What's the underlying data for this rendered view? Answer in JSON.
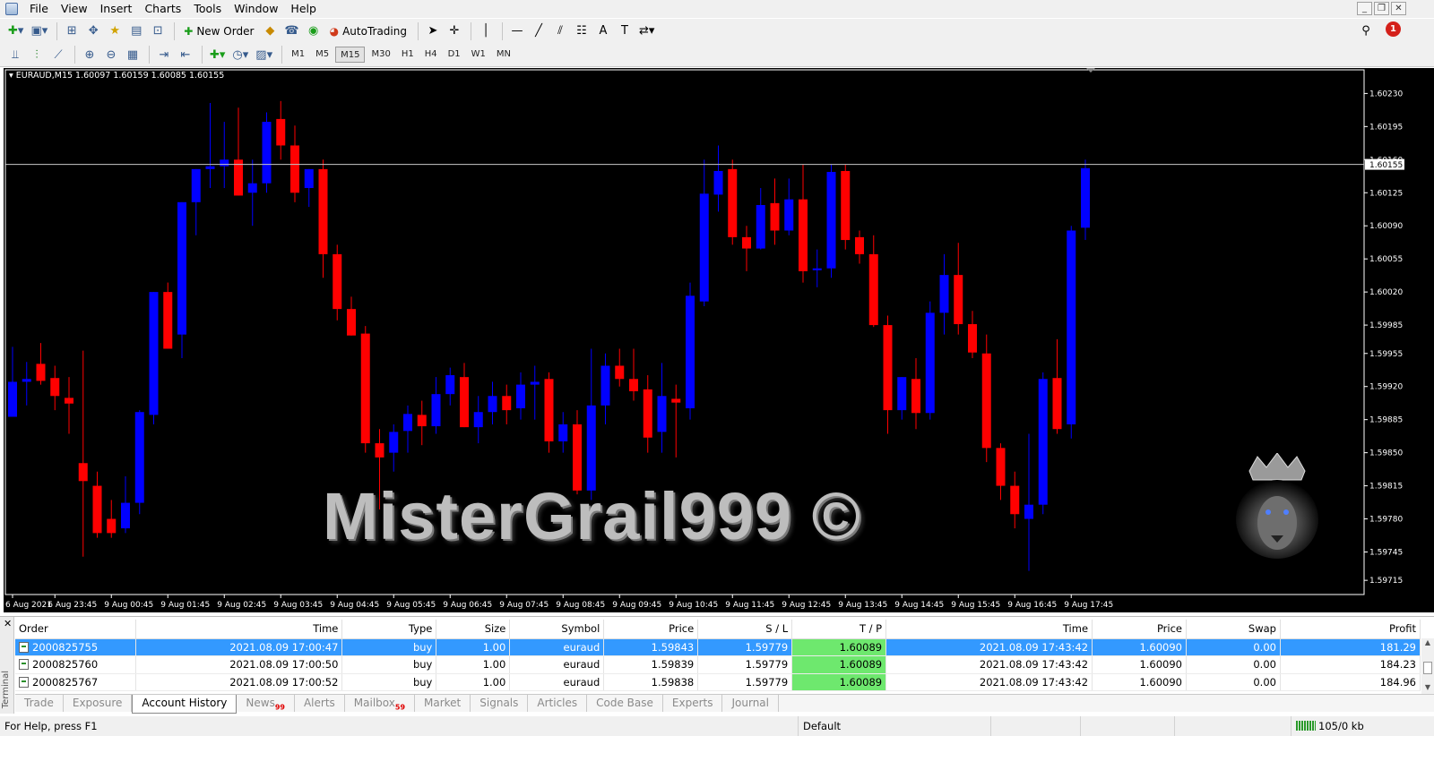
{
  "menu": [
    "File",
    "View",
    "Insert",
    "Charts",
    "Tools",
    "Window",
    "Help"
  ],
  "toolbar": {
    "new_order": "New Order",
    "autotrading": "AutoTrading",
    "alert_count": "1"
  },
  "timeframes": [
    "M1",
    "M5",
    "M15",
    "M30",
    "H1",
    "H4",
    "D1",
    "W1",
    "MN"
  ],
  "active_timeframe": "M15",
  "chart": {
    "header": "EURAUD,M15  1.60097 1.60159 1.60085 1.60155",
    "current_price": "1.60155",
    "price_labels": [
      "1.60230",
      "1.60195",
      "1.60160",
      "1.60125",
      "1.60090",
      "1.60055",
      "1.60020",
      "1.59985",
      "1.59955",
      "1.59920",
      "1.59885",
      "1.59850",
      "1.59815",
      "1.59780",
      "1.59745",
      "1.59715"
    ],
    "time_labels": [
      "6 Aug 2021",
      "6 Aug 23:45",
      "9 Aug 00:45",
      "9 Aug 01:45",
      "9 Aug 02:45",
      "9 Aug 03:45",
      "9 Aug 04:45",
      "9 Aug 05:45",
      "9 Aug 06:45",
      "9 Aug 07:45",
      "9 Aug 08:45",
      "9 Aug 09:45",
      "9 Aug 10:45",
      "9 Aug 11:45",
      "9 Aug 12:45",
      "9 Aug 13:45",
      "9 Aug 14:45",
      "9 Aug 15:45",
      "9 Aug 16:45",
      "9 Aug 17:45"
    ],
    "watermark": "MisterGrail999 ©",
    "bull_color": "#0000ff",
    "bear_color": "#ff0000"
  },
  "chart_data": {
    "type": "candlestick",
    "symbol": "EURAUD",
    "timeframe": "M15",
    "ylim": [
      1.597,
      1.60255
    ],
    "candles": [
      {
        "o": 1.59888,
        "h": 1.59962,
        "l": 1.59888,
        "c": 1.59925
      },
      {
        "o": 1.59925,
        "h": 1.59946,
        "l": 1.599,
        "c": 1.59928
      },
      {
        "o": 1.59944,
        "h": 1.59966,
        "l": 1.59922,
        "c": 1.59926
      },
      {
        "o": 1.59929,
        "h": 1.59942,
        "l": 1.59895,
        "c": 1.5991
      },
      {
        "o": 1.59908,
        "h": 1.5993,
        "l": 1.5987,
        "c": 1.59902
      },
      {
        "o": 1.59839,
        "h": 1.59958,
        "l": 1.5974,
        "c": 1.5982
      },
      {
        "o": 1.59815,
        "h": 1.5983,
        "l": 1.5976,
        "c": 1.59765
      },
      {
        "o": 1.5978,
        "h": 1.598,
        "l": 1.5976,
        "c": 1.59765
      },
      {
        "o": 1.5977,
        "h": 1.59825,
        "l": 1.59765,
        "c": 1.59797
      },
      {
        "o": 1.59797,
        "h": 1.59895,
        "l": 1.59785,
        "c": 1.59893
      },
      {
        "o": 1.5989,
        "h": 1.59985,
        "l": 1.5988,
        "c": 1.6002
      },
      {
        "o": 1.6002,
        "h": 1.6003,
        "l": 1.5996,
        "c": 1.5996
      },
      {
        "o": 1.59975,
        "h": 1.601,
        "l": 1.5995,
        "c": 1.60115
      },
      {
        "o": 1.60115,
        "h": 1.6014,
        "l": 1.6008,
        "c": 1.6015
      },
      {
        "o": 1.6015,
        "h": 1.6022,
        "l": 1.6013,
        "c": 1.60153
      },
      {
        "o": 1.60153,
        "h": 1.602,
        "l": 1.6013,
        "c": 1.6016
      },
      {
        "o": 1.6016,
        "h": 1.60215,
        "l": 1.60135,
        "c": 1.60122
      },
      {
        "o": 1.60125,
        "h": 1.6016,
        "l": 1.6009,
        "c": 1.60135
      },
      {
        "o": 1.60135,
        "h": 1.6021,
        "l": 1.60125,
        "c": 1.602
      },
      {
        "o": 1.60203,
        "h": 1.60222,
        "l": 1.6016,
        "c": 1.60175
      },
      {
        "o": 1.60175,
        "h": 1.60196,
        "l": 1.60115,
        "c": 1.60125
      },
      {
        "o": 1.6013,
        "h": 1.6015,
        "l": 1.6011,
        "c": 1.6015
      },
      {
        "o": 1.6015,
        "h": 1.6016,
        "l": 1.60035,
        "c": 1.6006
      },
      {
        "o": 1.6006,
        "h": 1.6007,
        "l": 1.5999,
        "c": 1.60002
      },
      {
        "o": 1.60002,
        "h": 1.60015,
        "l": 1.5998,
        "c": 1.59974
      },
      {
        "o": 1.59976,
        "h": 1.59984,
        "l": 1.5985,
        "c": 1.5986
      },
      {
        "o": 1.5986,
        "h": 1.59875,
        "l": 1.5979,
        "c": 1.59845
      },
      {
        "o": 1.5985,
        "h": 1.5988,
        "l": 1.5983,
        "c": 1.59872
      },
      {
        "o": 1.59873,
        "h": 1.599,
        "l": 1.5985,
        "c": 1.59891
      },
      {
        "o": 1.5989,
        "h": 1.59905,
        "l": 1.59858,
        "c": 1.59878
      },
      {
        "o": 1.59878,
        "h": 1.5993,
        "l": 1.5987,
        "c": 1.59912
      },
      {
        "o": 1.59912,
        "h": 1.5994,
        "l": 1.599,
        "c": 1.59932
      },
      {
        "o": 1.5993,
        "h": 1.59945,
        "l": 1.5988,
        "c": 1.59877
      },
      {
        "o": 1.59877,
        "h": 1.5991,
        "l": 1.5986,
        "c": 1.59893
      },
      {
        "o": 1.59893,
        "h": 1.59925,
        "l": 1.5988,
        "c": 1.5991
      },
      {
        "o": 1.5991,
        "h": 1.59922,
        "l": 1.5988,
        "c": 1.59895
      },
      {
        "o": 1.59897,
        "h": 1.59935,
        "l": 1.59885,
        "c": 1.59922
      },
      {
        "o": 1.59922,
        "h": 1.59942,
        "l": 1.59885,
        "c": 1.59925
      },
      {
        "o": 1.59928,
        "h": 1.59935,
        "l": 1.5985,
        "c": 1.59862
      },
      {
        "o": 1.59862,
        "h": 1.59893,
        "l": 1.5985,
        "c": 1.5988
      },
      {
        "o": 1.5988,
        "h": 1.59895,
        "l": 1.59806,
        "c": 1.5981
      },
      {
        "o": 1.5981,
        "h": 1.5996,
        "l": 1.598,
        "c": 1.599
      },
      {
        "o": 1.599,
        "h": 1.59955,
        "l": 1.5988,
        "c": 1.59942
      },
      {
        "o": 1.59942,
        "h": 1.5996,
        "l": 1.5992,
        "c": 1.59928
      },
      {
        "o": 1.59928,
        "h": 1.5996,
        "l": 1.59905,
        "c": 1.59915
      },
      {
        "o": 1.59917,
        "h": 1.59932,
        "l": 1.5985,
        "c": 1.59866
      },
      {
        "o": 1.59872,
        "h": 1.59945,
        "l": 1.5985,
        "c": 1.5991
      },
      {
        "o": 1.59907,
        "h": 1.59922,
        "l": 1.59845,
        "c": 1.59903
      },
      {
        "o": 1.59897,
        "h": 1.6003,
        "l": 1.59885,
        "c": 1.60016
      },
      {
        "o": 1.6001,
        "h": 1.6016,
        "l": 1.60005,
        "c": 1.60124
      },
      {
        "o": 1.60123,
        "h": 1.60175,
        "l": 1.60105,
        "c": 1.60148
      },
      {
        "o": 1.6015,
        "h": 1.6016,
        "l": 1.6007,
        "c": 1.60078
      },
      {
        "o": 1.60078,
        "h": 1.6009,
        "l": 1.60042,
        "c": 1.60066
      },
      {
        "o": 1.60066,
        "h": 1.6013,
        "l": 1.60065,
        "c": 1.60112
      },
      {
        "o": 1.60114,
        "h": 1.6014,
        "l": 1.6007,
        "c": 1.60085
      },
      {
        "o": 1.60085,
        "h": 1.6014,
        "l": 1.6008,
        "c": 1.60118
      },
      {
        "o": 1.60118,
        "h": 1.60155,
        "l": 1.6003,
        "c": 1.60042
      },
      {
        "o": 1.60043,
        "h": 1.60065,
        "l": 1.60025,
        "c": 1.60045
      },
      {
        "o": 1.60045,
        "h": 1.60155,
        "l": 1.60035,
        "c": 1.60147
      },
      {
        "o": 1.60148,
        "h": 1.60155,
        "l": 1.60065,
        "c": 1.60075
      },
      {
        "o": 1.60078,
        "h": 1.60085,
        "l": 1.6005,
        "c": 1.6006
      },
      {
        "o": 1.6006,
        "h": 1.6008,
        "l": 1.59983,
        "c": 1.59985
      },
      {
        "o": 1.59985,
        "h": 1.59995,
        "l": 1.5987,
        "c": 1.59895
      },
      {
        "o": 1.59895,
        "h": 1.5993,
        "l": 1.59885,
        "c": 1.5993
      },
      {
        "o": 1.59928,
        "h": 1.5995,
        "l": 1.59875,
        "c": 1.59892
      },
      {
        "o": 1.59892,
        "h": 1.6001,
        "l": 1.59885,
        "c": 1.59998
      },
      {
        "o": 1.59998,
        "h": 1.6006,
        "l": 1.59975,
        "c": 1.60038
      },
      {
        "o": 1.60038,
        "h": 1.60072,
        "l": 1.59975,
        "c": 1.59986
      },
      {
        "o": 1.59986,
        "h": 1.6,
        "l": 1.5995,
        "c": 1.59956
      },
      {
        "o": 1.59955,
        "h": 1.59975,
        "l": 1.5984,
        "c": 1.59855
      },
      {
        "o": 1.59855,
        "h": 1.5986,
        "l": 1.598,
        "c": 1.59815
      },
      {
        "o": 1.59815,
        "h": 1.5983,
        "l": 1.5977,
        "c": 1.59785
      },
      {
        "o": 1.5978,
        "h": 1.5987,
        "l": 1.59725,
        "c": 1.59795
      },
      {
        "o": 1.59795,
        "h": 1.59935,
        "l": 1.59785,
        "c": 1.59928
      },
      {
        "o": 1.59929,
        "h": 1.5997,
        "l": 1.5987,
        "c": 1.59875
      },
      {
        "o": 1.5988,
        "h": 1.6009,
        "l": 1.59865,
        "c": 1.60085
      },
      {
        "o": 1.60088,
        "h": 1.6016,
        "l": 1.60075,
        "c": 1.60151
      }
    ]
  },
  "terminal": {
    "side_label": "Terminal",
    "columns": [
      "Order",
      "Time",
      "Type",
      "Size",
      "Symbol",
      "Price",
      "S / L",
      "T / P",
      "Time",
      "Price",
      "Swap",
      "Profit"
    ],
    "rows": [
      [
        "2000825755",
        "2021.08.09 17:00:47",
        "buy",
        "1.00",
        "euraud",
        "1.59843",
        "1.59779",
        "1.60089",
        "2021.08.09 17:43:42",
        "1.60090",
        "0.00",
        "181.29"
      ],
      [
        "2000825760",
        "2021.08.09 17:00:50",
        "buy",
        "1.00",
        "euraud",
        "1.59839",
        "1.59779",
        "1.60089",
        "2021.08.09 17:43:42",
        "1.60090",
        "0.00",
        "184.23"
      ],
      [
        "2000825767",
        "2021.08.09 17:00:52",
        "buy",
        "1.00",
        "euraud",
        "1.59838",
        "1.59779",
        "1.60089",
        "2021.08.09 17:43:42",
        "1.60090",
        "0.00",
        "184.96"
      ]
    ],
    "tabs": [
      {
        "label": "Trade",
        "badge": ""
      },
      {
        "label": "Exposure",
        "badge": ""
      },
      {
        "label": "Account History",
        "badge": "",
        "active": true
      },
      {
        "label": "News",
        "badge": "99"
      },
      {
        "label": "Alerts",
        "badge": ""
      },
      {
        "label": "Mailbox",
        "badge": "59"
      },
      {
        "label": "Market",
        "badge": ""
      },
      {
        "label": "Signals",
        "badge": ""
      },
      {
        "label": "Articles",
        "badge": ""
      },
      {
        "label": "Code Base",
        "badge": ""
      },
      {
        "label": "Experts",
        "badge": ""
      },
      {
        "label": "Journal",
        "badge": ""
      }
    ]
  },
  "status": {
    "help": "For Help, press F1",
    "profile": "Default",
    "traffic": "105/0 kb"
  }
}
